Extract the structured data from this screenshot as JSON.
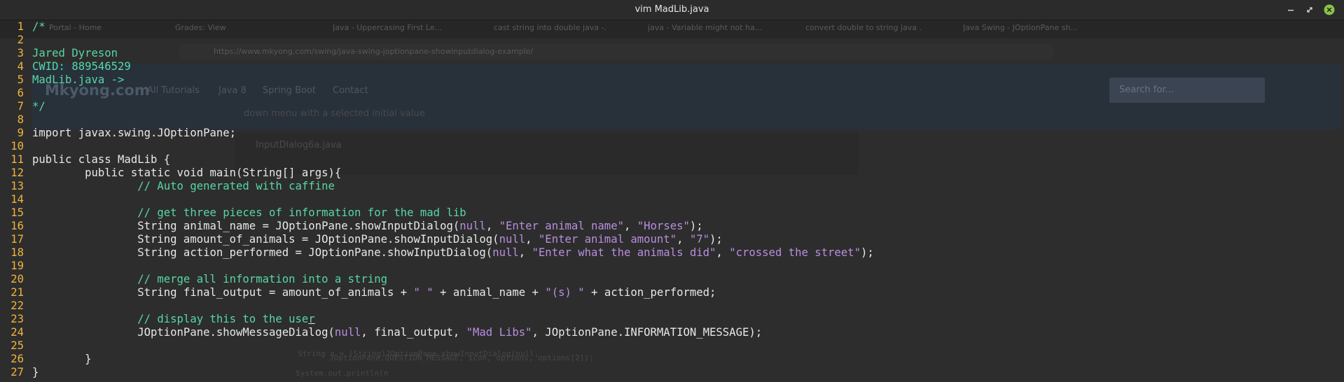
{
  "window": {
    "title": "vim MadLib.java"
  },
  "background_browser": {
    "tabs": [
      "Portal - Home",
      "Grades: View",
      "Java - Uppercasing First Le...",
      "cast string into double java -...",
      "java - Variable might not ha...",
      "convert double to string java ...",
      "Java Swing - JOptionPane sh..."
    ],
    "address": "https://www.mkyong.com/swing/java-swing-joptionpane-showinputdialog-example/",
    "brand": "Mkyong.com",
    "nav_links": [
      "All Tutorials",
      "Java 8",
      "Spring Boot",
      "Contact"
    ],
    "search_placeholder": "Search for...",
    "text_1": "down menu with a selected initial value",
    "text_2": "InputDialog6a.java",
    "code_1": "JOptionPane.QUESTION_MESSAGE, icon, options, options[2]);",
    "code_2": "System.out.println(n",
    "code_3": "String n = (String)JOptionPane.showInputDialog(null,"
  },
  "editor": {
    "file": "MadLib.java",
    "lines": [
      {
        "n": "1",
        "segments": [
          {
            "t": "/*",
            "c": "comment"
          }
        ]
      },
      {
        "n": "2",
        "segments": []
      },
      {
        "n": "3",
        "segments": [
          {
            "t": "Jared Dyreson",
            "c": "comment"
          }
        ]
      },
      {
        "n": "4",
        "segments": [
          {
            "t": "CWID: 889546529",
            "c": "comment"
          }
        ]
      },
      {
        "n": "5",
        "segments": [
          {
            "t": "MadLib.java ->",
            "c": "comment"
          }
        ]
      },
      {
        "n": "6",
        "segments": []
      },
      {
        "n": "7",
        "segments": [
          {
            "t": "*/",
            "c": "comment"
          }
        ]
      },
      {
        "n": "8",
        "segments": []
      },
      {
        "n": "9",
        "segments": [
          {
            "t": "import javax.swing.JOptionPane;",
            "c": "plain"
          }
        ]
      },
      {
        "n": "10",
        "segments": []
      },
      {
        "n": "11",
        "segments": [
          {
            "t": "public class MadLib {",
            "c": "plain"
          }
        ]
      },
      {
        "n": "12",
        "segments": [
          {
            "t": "        public static void main(String[] args){",
            "c": "plain"
          }
        ]
      },
      {
        "n": "13",
        "segments": [
          {
            "t": "                // Auto generated with caffine",
            "c": "comment"
          }
        ]
      },
      {
        "n": "14",
        "segments": []
      },
      {
        "n": "15",
        "segments": [
          {
            "t": "                // get three pieces of information for the mad lib",
            "c": "comment"
          }
        ]
      },
      {
        "n": "16",
        "segments": [
          {
            "t": "                String animal_name = JOptionPane.showInputDialog(",
            "c": "plain"
          },
          {
            "t": "null",
            "c": "str"
          },
          {
            "t": ", ",
            "c": "plain"
          },
          {
            "t": "\"Enter animal name\"",
            "c": "str"
          },
          {
            "t": ", ",
            "c": "plain"
          },
          {
            "t": "\"Horses\"",
            "c": "str"
          },
          {
            "t": ");",
            "c": "plain"
          }
        ]
      },
      {
        "n": "17",
        "segments": [
          {
            "t": "                String amount_of_animals = JOptionPane.showInputDialog(",
            "c": "plain"
          },
          {
            "t": "null",
            "c": "str"
          },
          {
            "t": ", ",
            "c": "plain"
          },
          {
            "t": "\"Enter animal amount\"",
            "c": "str"
          },
          {
            "t": ", ",
            "c": "plain"
          },
          {
            "t": "\"7\"",
            "c": "str"
          },
          {
            "t": ");",
            "c": "plain"
          }
        ]
      },
      {
        "n": "18",
        "segments": [
          {
            "t": "                String action_performed = JOptionPane.showInputDialog(",
            "c": "plain"
          },
          {
            "t": "null",
            "c": "str"
          },
          {
            "t": ", ",
            "c": "plain"
          },
          {
            "t": "\"Enter what the animals did\"",
            "c": "str"
          },
          {
            "t": ", ",
            "c": "plain"
          },
          {
            "t": "\"crossed the street\"",
            "c": "str"
          },
          {
            "t": ");",
            "c": "plain"
          }
        ]
      },
      {
        "n": "19",
        "segments": []
      },
      {
        "n": "20",
        "segments": [
          {
            "t": "                // merge all information into a string",
            "c": "comment"
          }
        ]
      },
      {
        "n": "21",
        "segments": [
          {
            "t": "                String final_output = amount_of_animals + ",
            "c": "plain"
          },
          {
            "t": "\" \"",
            "c": "str"
          },
          {
            "t": " + animal_name + ",
            "c": "plain"
          },
          {
            "t": "\"(s) \"",
            "c": "str"
          },
          {
            "t": " + action_performed;",
            "c": "plain"
          }
        ]
      },
      {
        "n": "22",
        "segments": []
      },
      {
        "n": "23",
        "segments": [
          {
            "t": "                // display this to the use",
            "c": "comment"
          },
          {
            "t": "r",
            "c": "comment",
            "cursor": true
          }
        ]
      },
      {
        "n": "24",
        "segments": [
          {
            "t": "                JOptionPane.showMessageDialog(",
            "c": "plain"
          },
          {
            "t": "null",
            "c": "str"
          },
          {
            "t": ", final_output, ",
            "c": "plain"
          },
          {
            "t": "\"Mad Libs\"",
            "c": "str"
          },
          {
            "t": ", JOptionPane.INFORMATION_MESSAGE);",
            "c": "plain"
          }
        ]
      },
      {
        "n": "25",
        "segments": []
      },
      {
        "n": "26",
        "segments": [
          {
            "t": "        }",
            "c": "plain"
          }
        ]
      },
      {
        "n": "27",
        "segments": [
          {
            "t": "}",
            "c": "plain"
          }
        ]
      }
    ]
  },
  "colors": {
    "line_number": "#f0b43c",
    "comment": "#57d7a4",
    "string": "#b98ee0",
    "text": "#e8e8e8",
    "background": "#2d2d2d"
  },
  "icons": {
    "minimize": "minimize-icon",
    "maximize": "maximize-icon",
    "close": "close-icon"
  }
}
